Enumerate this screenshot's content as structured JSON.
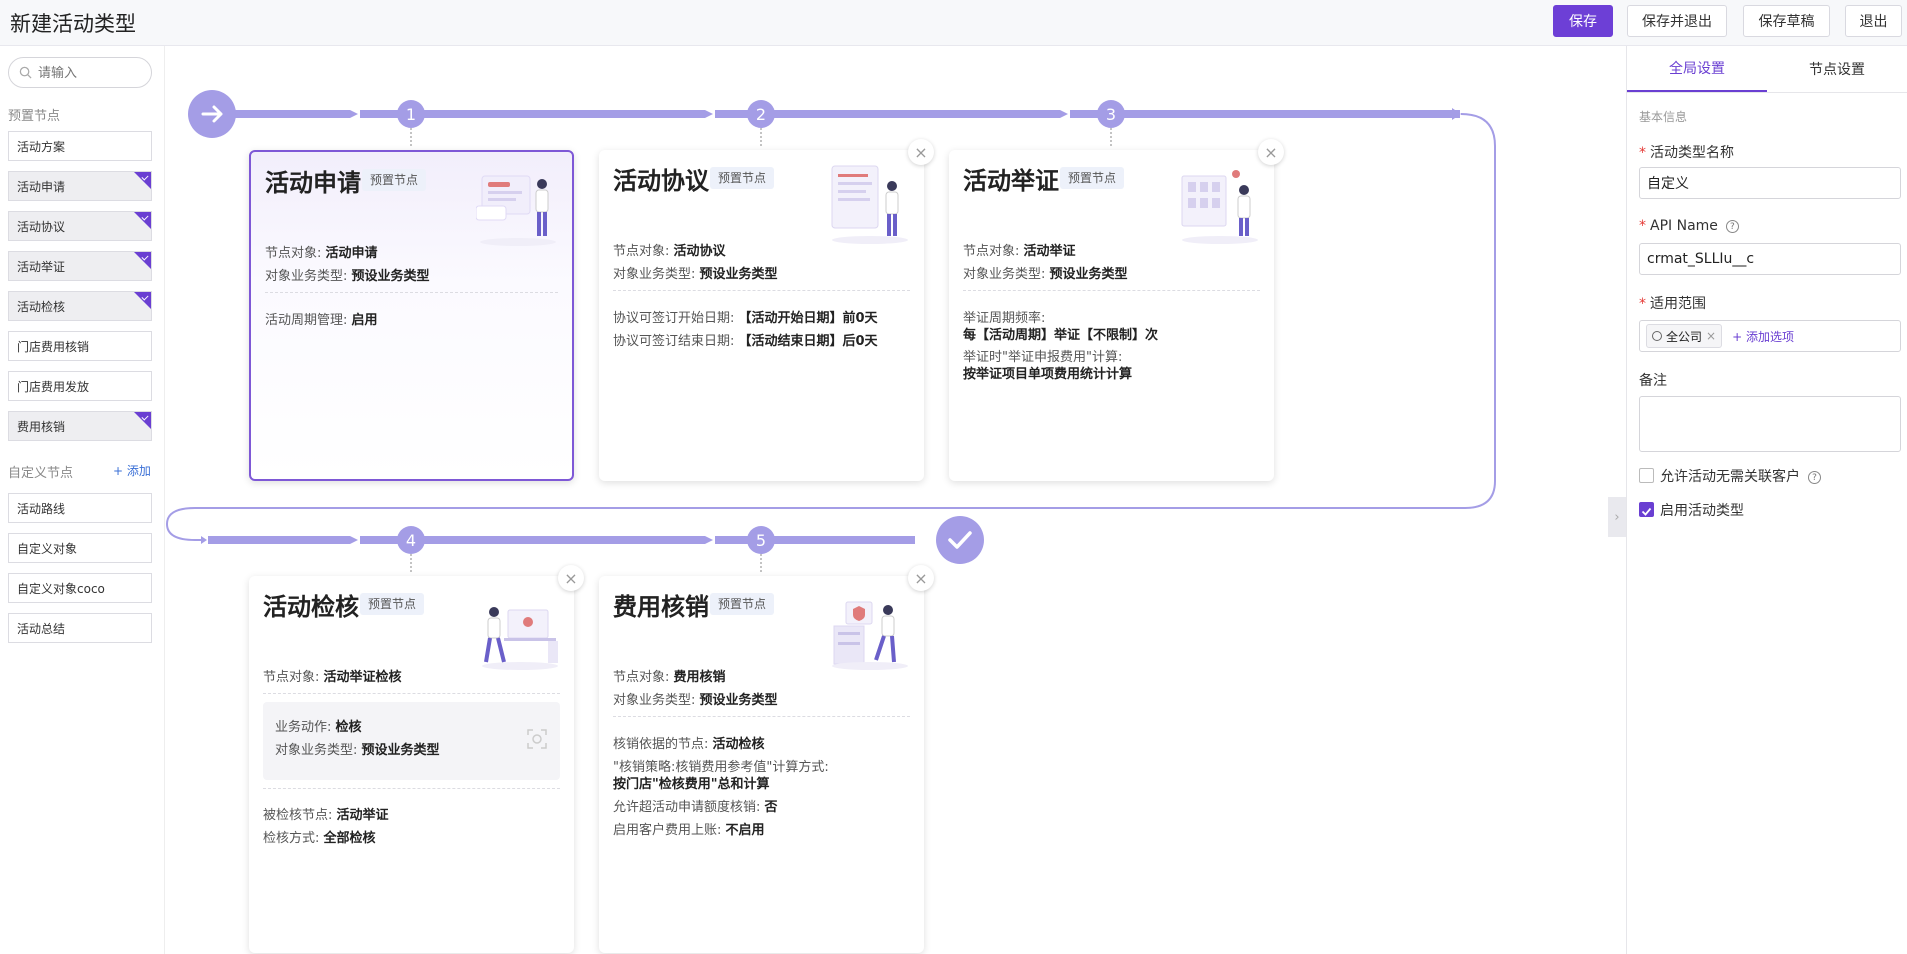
{
  "header": {
    "title": "新建活动类型",
    "buttons": {
      "save": "保存",
      "save_exit": "保存并退出",
      "save_draft": "保存草稿",
      "exit": "退出"
    }
  },
  "sidebar": {
    "search_placeholder": "请输入",
    "preset_label": "预置节点",
    "preset_items": [
      {
        "label": "活动方案",
        "used": false
      },
      {
        "label": "活动申请",
        "used": true
      },
      {
        "label": "活动协议",
        "used": true
      },
      {
        "label": "活动举证",
        "used": true
      },
      {
        "label": "活动检核",
        "used": true
      },
      {
        "label": "门店费用核销",
        "used": false
      },
      {
        "label": "门店费用发放",
        "used": false
      },
      {
        "label": "费用核销",
        "used": true
      }
    ],
    "custom_label": "自定义节点",
    "add_label": "+ 添加",
    "custom_items": [
      "活动路线",
      "自定义对象",
      "自定义对象coco",
      "活动总结"
    ]
  },
  "flow": {
    "steps": [
      "1",
      "2",
      "3",
      "4",
      "5"
    ],
    "cards": [
      {
        "title": "活动申请",
        "tag": "预置节点",
        "closable": false,
        "selected": true,
        "obj_label": "节点对象: ",
        "obj_value": "活动申请",
        "type_label": "对象业务类型: ",
        "type_value": "预设业务类型",
        "extra_label": "活动周期管理: ",
        "extra_value": "启用"
      },
      {
        "title": "活动协议",
        "tag": "预置节点",
        "closable": true,
        "close": "×",
        "obj_label": "节点对象: ",
        "obj_value": "活动协议",
        "type_label": "对象业务类型: ",
        "type_value": "预设业务类型",
        "start_label": "协议可签订开始日期: ",
        "start_value": "【活动开始日期】前0天",
        "end_label": "协议可签订结束日期: ",
        "end_value": "【活动结束日期】后0天"
      },
      {
        "title": "活动举证",
        "tag": "预置节点",
        "closable": true,
        "close": "×",
        "obj_label": "节点对象: ",
        "obj_value": "活动举证",
        "type_label": "对象业务类型: ",
        "type_value": "预设业务类型",
        "freq_label": "举证周期频率:",
        "freq_value": "每【活动周期】举证【不限制】次",
        "calc_label": "举证时\"举证申报费用\"计算:",
        "calc_value": "按举证项目单项费用统计计算"
      },
      {
        "title": "活动检核",
        "tag": "预置节点",
        "closable": true,
        "close": "×",
        "obj_label": "节点对象: ",
        "obj_value": "活动举证检核",
        "action_label": "业务动作: ",
        "action_value": "检核",
        "type_label": "对象业务类型: ",
        "type_value": "预设业务类型",
        "checked_label": "被检核节点: ",
        "checked_value": "活动举证",
        "mode_label": "检核方式: ",
        "mode_value": "全部检核"
      },
      {
        "title": "费用核销",
        "tag": "预置节点",
        "closable": true,
        "close": "×",
        "obj_label": "节点对象: ",
        "obj_value": "费用核销",
        "type_label": "对象业务类型: ",
        "type_value": "预设业务类型",
        "basis_label": "核销依据的节点: ",
        "basis_value": "活动检核",
        "policy_label": "\"核销策略:核销费用参考值\"计算方式:",
        "policy_value": "按门店\"检核费用\"总和计算",
        "over_label": "允许超活动申请额度核销: ",
        "over_value": "否",
        "account_label": "启用客户费用上账: ",
        "account_value": "不启用"
      }
    ]
  },
  "panel": {
    "tabs": [
      "全局设置",
      "节点设置"
    ],
    "active_tab": 0,
    "section": "基本信息",
    "name_label": "活动类型名称",
    "name_value": "自定义",
    "api_label": "API Name",
    "api_value": "crmat_SLLIu__c",
    "scope_label": "适用范围",
    "scope_chip": "全公司",
    "scope_add": "+ 添加选项",
    "remark_label": "备注",
    "remark_value": "",
    "opt1_label": "允许活动无需关联客户",
    "opt1_checked": false,
    "opt2_label": "启用活动类型",
    "opt2_checked": true
  },
  "colors": {
    "accent": "#6d3fd6",
    "flow": "#a49de6"
  }
}
